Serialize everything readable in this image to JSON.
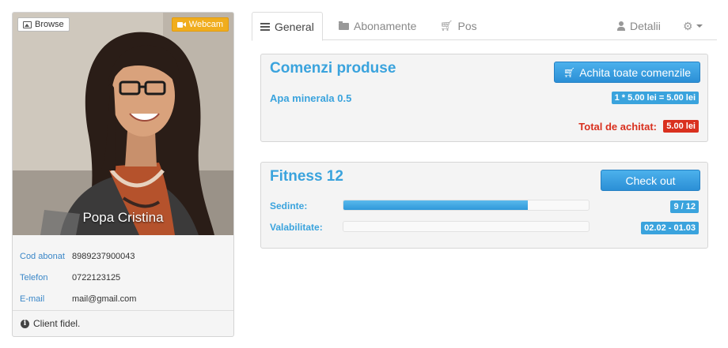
{
  "profile": {
    "browse_label": "Browse",
    "webcam_label": "Webcam",
    "name": "Popa Cristina",
    "info": [
      {
        "label": "Cod abonat",
        "value": "8989237900043"
      },
      {
        "label": "Telefon",
        "value": "0722123125"
      },
      {
        "label": "E-mail",
        "value": "mail@gmail.com"
      }
    ],
    "note": "Client fidel."
  },
  "tabs": [
    {
      "label": "General",
      "icon": "list-icon",
      "active": true
    },
    {
      "label": "Abonamente",
      "icon": "folder-open-icon",
      "active": false
    },
    {
      "label": "Pos",
      "icon": "cart-icon",
      "active": false
    }
  ],
  "tab_details": {
    "label": "Detalii",
    "icon": "user-icon"
  },
  "settings_icon": "gear-icon",
  "orders": {
    "title": "Comenzi produse",
    "pay_all_label": "Achita toate comenzile",
    "items": [
      {
        "name": "Apa minerala 0.5",
        "calc": "1 * 5.00 lei = 5.00 lei"
      }
    ],
    "total_label": "Total de achitat:",
    "total_value": "5.00 lei"
  },
  "subscription": {
    "title": "Fitness 12",
    "checkout_label": "Check out",
    "sessions_label": "Sedinte:",
    "sessions_used": 9,
    "sessions_total": 12,
    "sessions_badge": "9 / 12",
    "validity_label": "Valabilitate:",
    "validity_fraction": 0,
    "validity_badge": "02.02 - 01.03"
  },
  "colors": {
    "accent": "#3aa3dd",
    "danger": "#d9301e",
    "webcam": "#f0ad1e"
  }
}
